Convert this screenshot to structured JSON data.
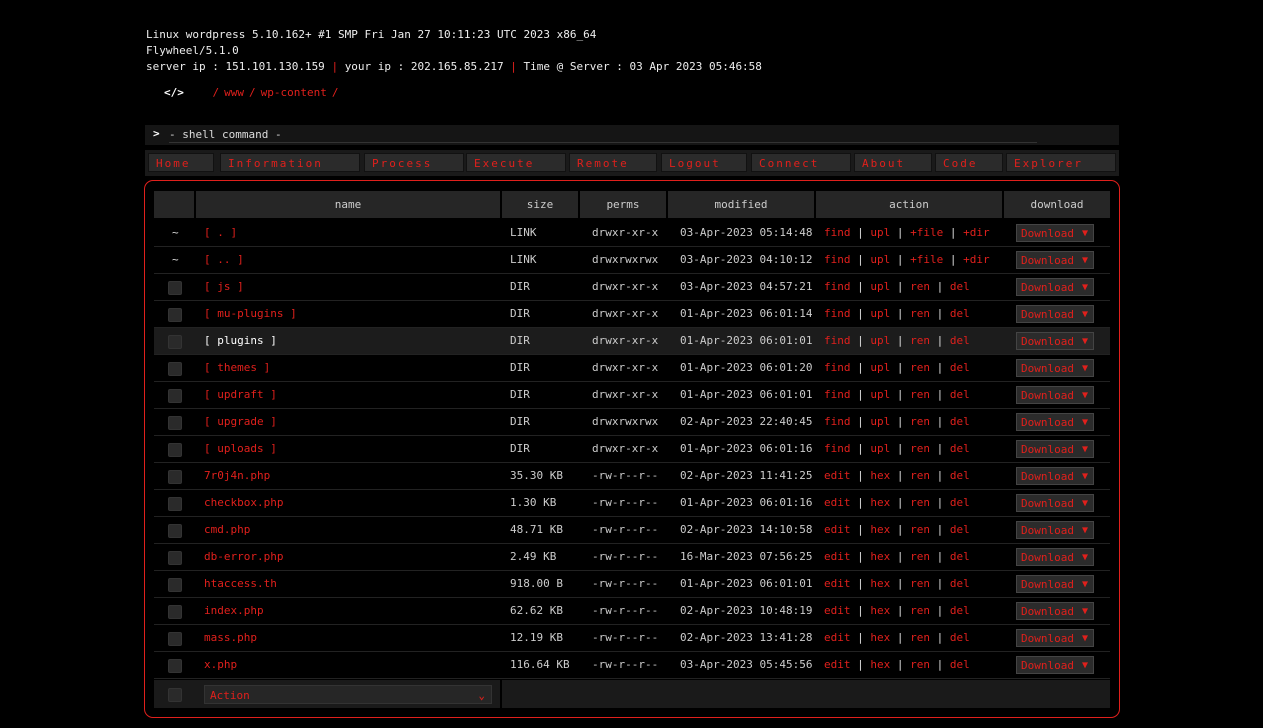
{
  "system": {
    "uname": "Linux wordpress 5.10.162+ #1 SMP Fri Jan 27 10:11:23 UTC 2023 x86_64",
    "software": "Flywheel/5.1.0",
    "server_ip": "server ip : 151.101.130.159",
    "your_ip": "your ip : 202.165.85.217",
    "time": "Time @ Server : 03 Apr 2023 05:46:58",
    "separator": "|"
  },
  "path": {
    "icon": "</>",
    "segments": [
      "/",
      "www",
      "/",
      "wp-content",
      "/"
    ]
  },
  "command": {
    "prompt": ">",
    "placeholder": "- shell command -"
  },
  "nav": [
    "Home",
    "Information",
    "Process",
    "Execute",
    "Remote",
    "Logout",
    "Connect",
    "About",
    "Code",
    "Explorer"
  ],
  "table": {
    "headers": {
      "name": "name",
      "size": "size",
      "perms": "perms",
      "modified": "modified",
      "action": "action",
      "download": "download"
    },
    "rows": [
      {
        "marker": "~",
        "name": "[ . ]",
        "size": "LINK",
        "perms": "drwxr-xr-x",
        "modified": "03-Apr-2023 05:14:48",
        "actions": [
          "find",
          "upl",
          "+file",
          "+dir"
        ],
        "download": "Download"
      },
      {
        "marker": "~",
        "name": "[ .. ]",
        "size": "LINK",
        "perms": "drwxrwxrwx",
        "modified": "03-Apr-2023 04:10:12",
        "actions": [
          "find",
          "upl",
          "+file",
          "+dir"
        ],
        "download": "Download"
      },
      {
        "marker": "",
        "name": "[ js ]",
        "size": "DIR",
        "perms": "drwxr-xr-x",
        "modified": "03-Apr-2023 04:57:21",
        "actions": [
          "find",
          "upl",
          "ren",
          "del"
        ],
        "download": "Download"
      },
      {
        "marker": "",
        "name": "[ mu-plugins ]",
        "size": "DIR",
        "perms": "drwxr-xr-x",
        "modified": "01-Apr-2023 06:01:14",
        "actions": [
          "find",
          "upl",
          "ren",
          "del"
        ],
        "download": "Download"
      },
      {
        "marker": "",
        "name": "[ plugins ]",
        "size": "DIR",
        "perms": "drwxr-xr-x",
        "modified": "01-Apr-2023 06:01:01",
        "actions": [
          "find",
          "upl",
          "ren",
          "del"
        ],
        "download": "Download"
      },
      {
        "marker": "",
        "name": "[ themes ]",
        "size": "DIR",
        "perms": "drwxr-xr-x",
        "modified": "01-Apr-2023 06:01:20",
        "actions": [
          "find",
          "upl",
          "ren",
          "del"
        ],
        "download": "Download"
      },
      {
        "marker": "",
        "name": "[ updraft ]",
        "size": "DIR",
        "perms": "drwxr-xr-x",
        "modified": "01-Apr-2023 06:01:01",
        "actions": [
          "find",
          "upl",
          "ren",
          "del"
        ],
        "download": "Download"
      },
      {
        "marker": "",
        "name": "[ upgrade ]",
        "size": "DIR",
        "perms": "drwxrwxrwx",
        "modified": "02-Apr-2023 22:40:45",
        "actions": [
          "find",
          "upl",
          "ren",
          "del"
        ],
        "download": "Download"
      },
      {
        "marker": "",
        "name": "[ uploads ]",
        "size": "DIR",
        "perms": "drwxr-xr-x",
        "modified": "01-Apr-2023 06:01:16",
        "actions": [
          "find",
          "upl",
          "ren",
          "del"
        ],
        "download": "Download"
      },
      {
        "marker": "",
        "name": "7r0j4n.php",
        "size": "35.30 KB",
        "perms": "-rw-r--r--",
        "modified": "02-Apr-2023 11:41:25",
        "actions": [
          "edit",
          "hex",
          "ren",
          "del"
        ],
        "download": "Download"
      },
      {
        "marker": "",
        "name": "checkbox.php",
        "size": "1.30 KB",
        "perms": "-rw-r--r--",
        "modified": "01-Apr-2023 06:01:16",
        "actions": [
          "edit",
          "hex",
          "ren",
          "del"
        ],
        "download": "Download"
      },
      {
        "marker": "",
        "name": "cmd.php",
        "size": "48.71 KB",
        "perms": "-rw-r--r--",
        "modified": "02-Apr-2023 14:10:58",
        "actions": [
          "edit",
          "hex",
          "ren",
          "del"
        ],
        "download": "Download"
      },
      {
        "marker": "",
        "name": "db-error.php",
        "size": "2.49 KB",
        "perms": "-rw-r--r--",
        "modified": "16-Mar-2023 07:56:25",
        "actions": [
          "edit",
          "hex",
          "ren",
          "del"
        ],
        "download": "Download"
      },
      {
        "marker": "",
        "name": "htaccess.th",
        "size": "918.00 B",
        "perms": "-rw-r--r--",
        "modified": "01-Apr-2023 06:01:01",
        "actions": [
          "edit",
          "hex",
          "ren",
          "del"
        ],
        "download": "Download"
      },
      {
        "marker": "",
        "name": "index.php",
        "size": "62.62 KB",
        "perms": "-rw-r--r--",
        "modified": "02-Apr-2023 10:48:19",
        "actions": [
          "edit",
          "hex",
          "ren",
          "del"
        ],
        "download": "Download"
      },
      {
        "marker": "",
        "name": "mass.php",
        "size": "12.19 KB",
        "perms": "-rw-r--r--",
        "modified": "02-Apr-2023 13:41:28",
        "actions": [
          "edit",
          "hex",
          "ren",
          "del"
        ],
        "download": "Download"
      },
      {
        "marker": "",
        "name": "x.php",
        "size": "116.64 KB",
        "perms": "-rw-r--r--",
        "modified": "03-Apr-2023 05:45:56",
        "actions": [
          "edit",
          "hex",
          "ren",
          "del"
        ],
        "download": "Download"
      }
    ],
    "highlighted": "[ plugins ]"
  },
  "footer": {
    "action_label": "Action"
  },
  "colors": {
    "accent": "#e0201c",
    "background": "#000000",
    "panel": "#262626"
  }
}
